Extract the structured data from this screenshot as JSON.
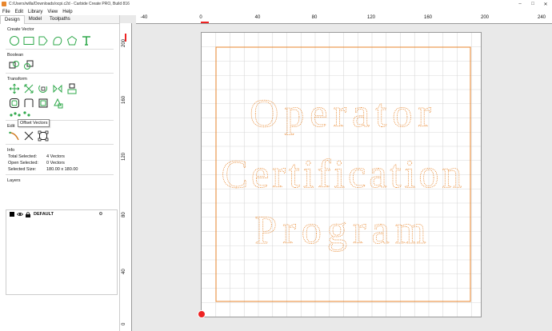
{
  "window": {
    "title": "C:/Users/willa/Downloads/ocpi.c2d - Carbide Create PRO, Build 816",
    "minimize": "–",
    "maximize": "□",
    "close": "✕"
  },
  "menu": [
    "File",
    "Edit",
    "Library",
    "View",
    "Help"
  ],
  "tabs": [
    "Design",
    "Model",
    "Toolpaths"
  ],
  "active_tab": "Design",
  "sections": {
    "create_vector": "Create Vector",
    "boolean": "Boolean",
    "transform": "Transform",
    "edit": "Edit",
    "info": "Info",
    "layers": "Layers"
  },
  "icons": {
    "create_vector": [
      "circle-icon",
      "rectangle-icon",
      "polygon-icon",
      "curve-icon",
      "pentagon-icon",
      "text-icon"
    ],
    "boolean": [
      "union-icon",
      "subtract-icon"
    ],
    "transform_row1": [
      "move-icon",
      "scale-icon",
      "rotate-icon",
      "mirror-icon",
      "align-icon"
    ],
    "transform_row2": [
      "offset-vectors-icon",
      "join-icon",
      "group-icon",
      "triangle-shapes-icon"
    ],
    "edit": [
      "node-edit-icon",
      "trim-icon",
      "bounding-box-icon"
    ]
  },
  "tooltip": "Offset Vectors",
  "info": {
    "total_selected_label": "Total Selected:",
    "total_selected_value": "4 Vectors",
    "open_selected_label": "Open Selected:",
    "open_selected_value": "0 Vectors",
    "selected_size_label": "Selected Size:",
    "selected_size_value": "180.00 x 180.00"
  },
  "layers": [
    {
      "name": "DEFAULT",
      "color": "#000000",
      "visible": true,
      "locked": true
    }
  ],
  "canvas": {
    "ruler_x": [
      "-40",
      "0",
      "40",
      "80",
      "120",
      "160",
      "200",
      "240"
    ],
    "ruler_y": [
      "200",
      "160",
      "120",
      "80",
      "40",
      "0"
    ],
    "text_lines": [
      "Operator",
      "Certification",
      "Program"
    ],
    "vector_color": "#e8862c",
    "grid_color": "#d8d8d8"
  }
}
